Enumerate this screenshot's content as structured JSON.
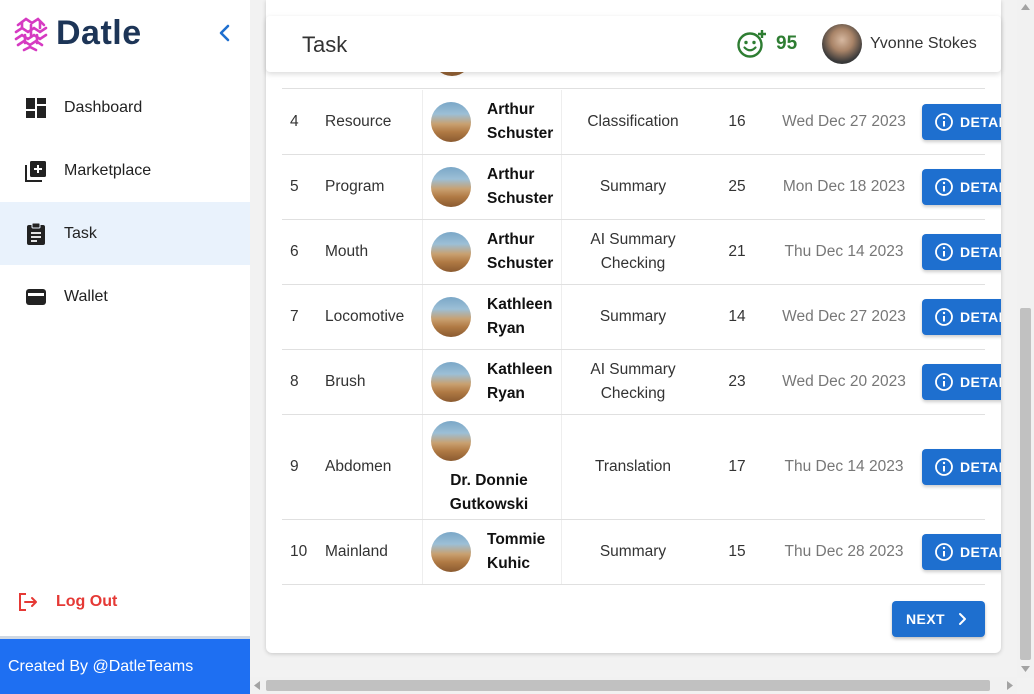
{
  "brand": {
    "name": "Datle"
  },
  "sidebar": {
    "items": [
      {
        "label": "Dashboard",
        "icon": "dashboard-icon"
      },
      {
        "label": "Marketplace",
        "icon": "add-box-icon"
      },
      {
        "label": "Task",
        "icon": "clipboard-icon"
      },
      {
        "label": "Wallet",
        "icon": "wallet-icon"
      }
    ],
    "active": "Task",
    "logout_label": "Log Out",
    "footer": "Created By @DatleTeams"
  },
  "header": {
    "title": "Task",
    "points": "95",
    "user_name": "Yvonne Stokes"
  },
  "table": {
    "rows": [
      {
        "num": "4",
        "name": "Resource",
        "user": "Arthur Schuster",
        "type": "Classification",
        "count": "16",
        "date": "Wed Dec 27 2023",
        "action": "DETAIL"
      },
      {
        "num": "5",
        "name": "Program",
        "user": "Arthur Schuster",
        "type": "Summary",
        "count": "25",
        "date": "Mon Dec 18 2023",
        "action": "DETAIL"
      },
      {
        "num": "6",
        "name": "Mouth",
        "user": "Arthur Schuster",
        "type": "AI Summary Checking",
        "count": "21",
        "date": "Thu Dec 14 2023",
        "action": "DETAIL"
      },
      {
        "num": "7",
        "name": "Locomotive",
        "user": "Kathleen Ryan",
        "type": "Summary",
        "count": "14",
        "date": "Wed Dec 27 2023",
        "action": "DETAIL"
      },
      {
        "num": "8",
        "name": "Brush",
        "user": "Kathleen Ryan",
        "type": "AI Summary Checking",
        "count": "23",
        "date": "Wed Dec 20 2023",
        "action": "DETAIL"
      },
      {
        "num": "9",
        "name": "Abdomen",
        "user": "Dr. Donnie Gutkowski",
        "type": "Translation",
        "count": "17",
        "date": "Thu Dec 14 2023",
        "action": "DETAIL"
      },
      {
        "num": "10",
        "name": "Mainland",
        "user": "Tommie Kuhic",
        "type": "Summary",
        "count": "15",
        "date": "Thu Dec 28 2023",
        "action": "DETAIL"
      }
    ],
    "next_label": "NEXT"
  },
  "colors": {
    "primary": "#1e6fcf",
    "footer": "#1e6ff2",
    "logout": "#e53935",
    "points": "#2e7d32",
    "logo_mark": "#d63ac2"
  }
}
